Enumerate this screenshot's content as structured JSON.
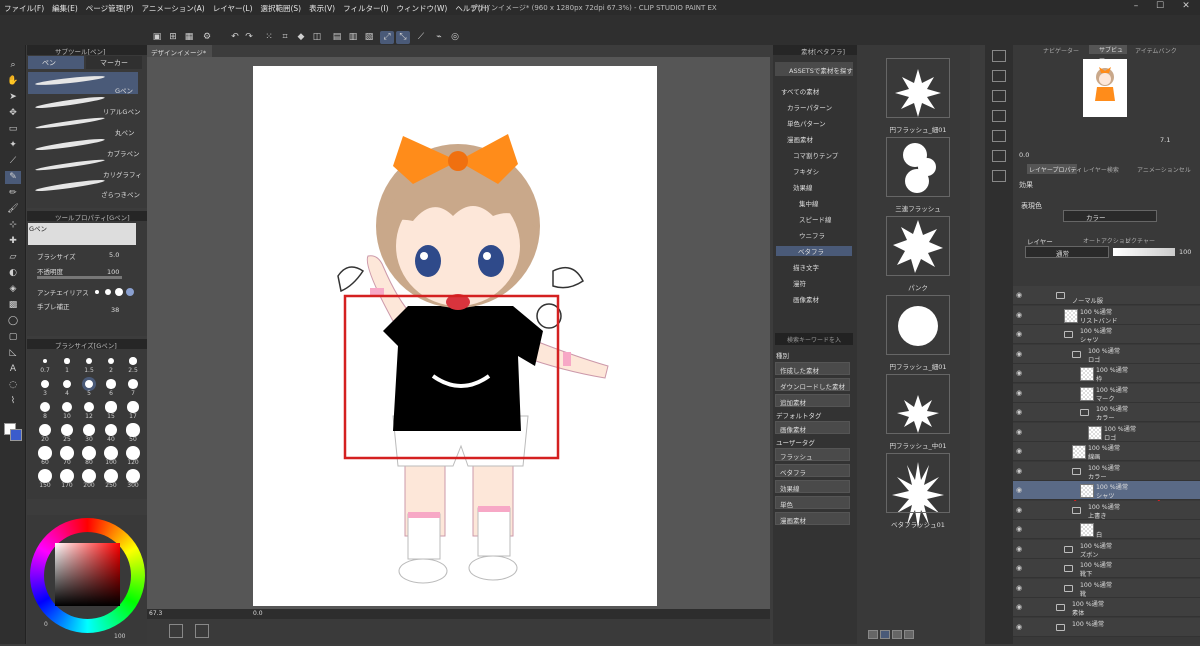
{
  "app": {
    "title": "デザインイメージ* (960 x 1280px 72dpi 67.3%) - CLIP STUDIO PAINT EX",
    "menu": [
      "ファイル(F)",
      "編集(E)",
      "ページ管理(P)",
      "アニメーション(A)",
      "レイヤー(L)",
      "選択範囲(S)",
      "表示(V)",
      "フィルター(I)",
      "ウィンドウ(W)",
      "ヘルプ(H)"
    ],
    "window_controls": [
      "–",
      "☐",
      "✕"
    ]
  },
  "subtool": {
    "tabs": [
      "ペン",
      "マーカー"
    ],
    "header": "サブツール[ペン]",
    "items": [
      "Gペン",
      "リアルGペン",
      "丸ペン",
      "カブラペン",
      "カリグラフィ",
      "ざらつきペン"
    ]
  },
  "tool_property": {
    "header": "ツールプロパティ[Gペン]",
    "name": "Gペン",
    "brush_size_label": "ブラシサイズ",
    "brush_size_value": "5.0",
    "opacity_label": "不透明度",
    "opacity_value": "100",
    "antialias_label": "アンチエイリアス",
    "stabilization_label": "手ブレ補正",
    "stabilization_value": "38"
  },
  "brush_size": {
    "header": "ブラシサイズ[Gペン]",
    "sizes": [
      "0.7",
      "1",
      "1.5",
      "2",
      "2.5",
      "3",
      "4",
      "5",
      "6",
      "7",
      "8",
      "10",
      "12",
      "15",
      "17",
      "20",
      "25",
      "30",
      "40",
      "50",
      "60",
      "70",
      "80",
      "100",
      "120",
      "150",
      "170",
      "200",
      "250",
      "300"
    ]
  },
  "document": {
    "tab": "デザインイメージ*",
    "zoom": "67.3",
    "angle": "0.0"
  },
  "material": {
    "header": "素材[ベタフラ]",
    "tree_root": "ASSETSで素材を探す",
    "tree": [
      "すべての素材",
      "カラーパターン",
      "単色パターン",
      "漫画素材",
      "コマ割りテンプ",
      "フキダシ",
      "効果線",
      "集中線",
      "スピード線",
      "ウニフラ",
      "ベタフラ",
      "描き文字",
      "漫符",
      "画像素材"
    ],
    "search_placeholder": "検索キーワードを入",
    "kind_label": "種別",
    "kind_buttons": [
      "作成した素材",
      "ダウンロードした素材",
      "追加素材"
    ],
    "default_tag_label": "デフォルトタグ",
    "default_tags": [
      "画像素材"
    ],
    "user_tag_label": "ユーザータグ",
    "user_tags": [
      "フラッシュ",
      "ベタフラ",
      "効果線",
      "単色",
      "漫画素材"
    ],
    "thumbnails": [
      "円フラッシュ_細01",
      "三連フラッシュ",
      "パンク",
      "円フラッシュ_細01",
      "円フラッシュ_中01",
      "ベタフラッシュ01"
    ]
  },
  "navigator": {
    "tabs": [
      "ナビゲーター",
      "サブビュー",
      "アイテムバンク"
    ],
    "zoom": "7.1",
    "angle": "0.0"
  },
  "layer_property": {
    "tabs": [
      "レイヤープロパティ",
      "レイヤー検索",
      "アニメーションセル"
    ],
    "effect_label": "効果",
    "color_label": "表現色",
    "color_value": "カラー"
  },
  "layers": {
    "tabs": [
      "レイヤー",
      "オートアクション",
      "ピクチャー"
    ],
    "blend": "通常",
    "opacity": "100",
    "rows": [
      {
        "pct": "",
        "name": "ノーマル服"
      },
      {
        "pct": "100 %通常",
        "name": "リストバンド"
      },
      {
        "pct": "100 %通常",
        "name": "シャツ"
      },
      {
        "pct": "100 %通常",
        "name": "ロゴ"
      },
      {
        "pct": "100 %通常",
        "name": "枠"
      },
      {
        "pct": "100 %通常",
        "name": "マーク"
      },
      {
        "pct": "100 %通常",
        "name": "カラー"
      },
      {
        "pct": "100 %通常",
        "name": "ロゴ"
      },
      {
        "pct": "100 %通常",
        "name": "線画"
      },
      {
        "pct": "100 %通常",
        "name": "カラー"
      },
      {
        "pct": "100 %通常",
        "name": "シャツ"
      },
      {
        "pct": "100 %通常",
        "name": "上書き"
      },
      {
        "pct": "",
        "name": "白"
      },
      {
        "pct": "100 %通常",
        "name": "ズボン"
      },
      {
        "pct": "100 %通常",
        "name": "靴下"
      },
      {
        "pct": "100 %通常",
        "name": "靴"
      },
      {
        "pct": "100 %通常",
        "name": "素体"
      },
      {
        "pct": "100 %通常",
        "name": ""
      }
    ]
  },
  "bottom": {
    "color_value": "0",
    "color_value2": "100"
  },
  "colors": {
    "accent": "#5a6a86",
    "highlight_red": "#d42020",
    "bow": "#ff8c1a",
    "hair": "#c9a88a"
  }
}
